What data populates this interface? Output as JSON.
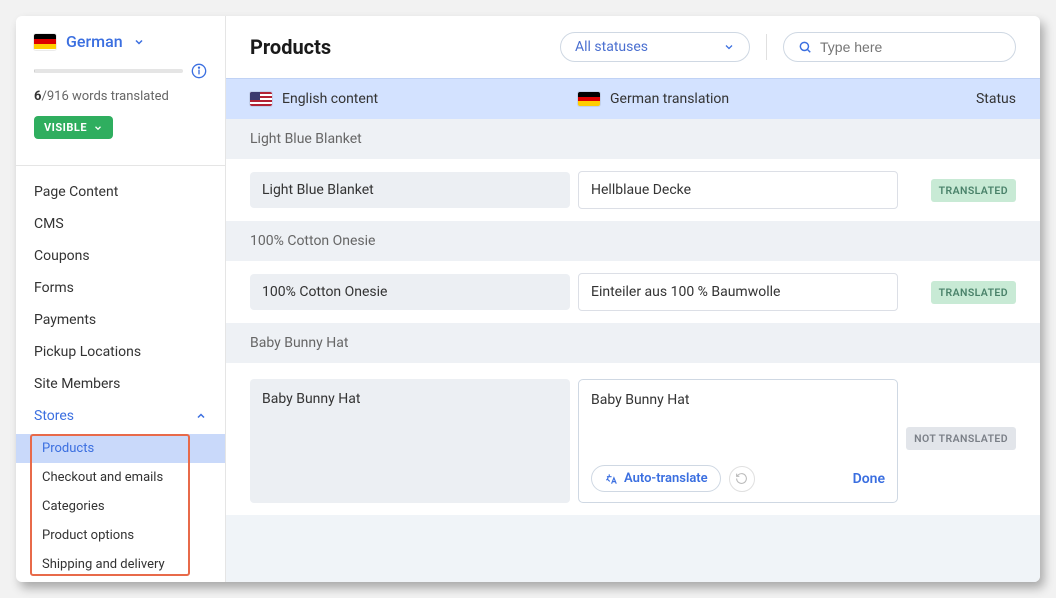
{
  "sidebar": {
    "language_name": "German",
    "words_done": "6",
    "words_total": "916",
    "words_suffix": "words translated",
    "visible_label": "VISIBLE",
    "nav_items": [
      "Page Content",
      "CMS",
      "Coupons",
      "Forms",
      "Payments",
      "Pickup Locations",
      "Site Members"
    ],
    "stores_label": "Stores",
    "stores_sub": [
      "Products",
      "Checkout and emails",
      "Categories",
      "Product options",
      "Shipping and delivery"
    ]
  },
  "main": {
    "title": "Products",
    "status_select": "All statuses",
    "search_placeholder": "Type here",
    "col_en": "English content",
    "col_de": "German translation",
    "col_status": "Status",
    "groups": [
      {
        "header": "Light Blue Blanket",
        "src": "Light Blue Blanket",
        "trg": "Hellblaue Decke",
        "status": "TRANSLATED",
        "status_class": "chip-translated"
      },
      {
        "header": "100% Cotton Onesie",
        "src": "100% Cotton Onesie",
        "trg": "Einteiler aus 100 % Baumwolle",
        "status": "TRANSLATED",
        "status_class": "chip-translated"
      }
    ],
    "editing_group": {
      "header": "Baby Bunny Hat",
      "src": "Baby Bunny Hat",
      "trg": "Baby Bunny Hat",
      "status": "NOT TRANSLATED",
      "auto_label": "Auto-translate",
      "done_label": "Done"
    }
  }
}
